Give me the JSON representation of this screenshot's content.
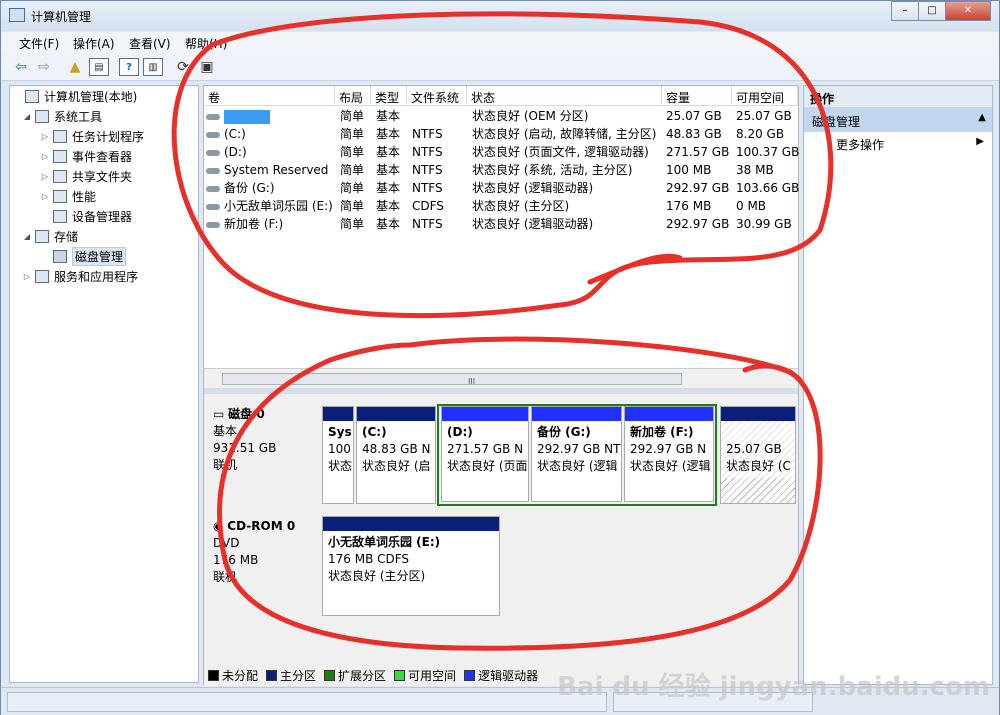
{
  "window": {
    "title": "计算机管理",
    "btn_min": "–",
    "btn_max": "□",
    "btn_close": "✕"
  },
  "menu": [
    "文件(F)",
    "操作(A)",
    "查看(V)",
    "帮助(H)"
  ],
  "tree": [
    {
      "label": "计算机管理(本地)",
      "expander": ""
    },
    {
      "label": "系统工具",
      "expander": "◢"
    },
    {
      "label": "任务计划程序",
      "expander": "▷"
    },
    {
      "label": "事件查看器",
      "expander": "▷"
    },
    {
      "label": "共享文件夹",
      "expander": "▷"
    },
    {
      "label": "性能",
      "expander": "▷"
    },
    {
      "label": "设备管理器",
      "expander": ""
    },
    {
      "label": "存储",
      "expander": "◢"
    },
    {
      "label": "磁盘管理",
      "expander": ""
    },
    {
      "label": "服务和应用程序",
      "expander": "▷"
    }
  ],
  "columns": [
    "卷",
    "布局",
    "类型",
    "文件系统",
    "状态",
    "容量",
    "可用空间"
  ],
  "volumes": [
    {
      "name": "",
      "layout": "简单",
      "type": "基本",
      "fs": "",
      "status": "状态良好 (OEM 分区)",
      "capacity": "25.07 GB",
      "free": "25.07 GB"
    },
    {
      "name": "(C:)",
      "layout": "简单",
      "type": "基本",
      "fs": "NTFS",
      "status": "状态良好 (启动, 故障转储, 主分区)",
      "capacity": "48.83 GB",
      "free": "8.20 GB"
    },
    {
      "name": "(D:)",
      "layout": "简单",
      "type": "基本",
      "fs": "NTFS",
      "status": "状态良好 (页面文件, 逻辑驱动器)",
      "capacity": "271.57 GB",
      "free": "100.37 GB"
    },
    {
      "name": "System Reserved",
      "layout": "简单",
      "type": "基本",
      "fs": "NTFS",
      "status": "状态良好 (系统, 活动, 主分区)",
      "capacity": "100 MB",
      "free": "38 MB"
    },
    {
      "name": "备份 (G:)",
      "layout": "简单",
      "type": "基本",
      "fs": "NTFS",
      "status": "状态良好 (逻辑驱动器)",
      "capacity": "292.97 GB",
      "free": "103.66 GB"
    },
    {
      "name": "小无敌单词乐园 (E:)",
      "layout": "简单",
      "type": "基本",
      "fs": "CDFS",
      "status": "状态良好 (主分区)",
      "capacity": "176 MB",
      "free": "0 MB"
    },
    {
      "name": "新加卷 (F:)",
      "layout": "简单",
      "type": "基本",
      "fs": "NTFS",
      "status": "状态良好 (逻辑驱动器)",
      "capacity": "292.97 GB",
      "free": "30.99 GB"
    }
  ],
  "scroll_thumb": "III",
  "disk0": {
    "title": "磁盘 0",
    "kind": "基本",
    "size": "931.51 GB",
    "state": "联机"
  },
  "cdrom": {
    "title": "CD-ROM 0",
    "kind": "DVD",
    "size": "176 MB",
    "state": "联机"
  },
  "partitions": [
    {
      "name": "Sys",
      "size": "100",
      "status": "状态"
    },
    {
      "name": "(C:)",
      "size": "48.83 GB N",
      "status": "状态良好 (启"
    },
    {
      "name": "(D:)",
      "size": "271.57 GB N",
      "status": "状态良好 (页面"
    },
    {
      "name": "备份 (G:)",
      "size": "292.97 GB NT",
      "status": "状态良好 (逻辑"
    },
    {
      "name": "新加卷 (F:)",
      "size": "292.97 GB N",
      "status": "状态良好 (逻辑"
    },
    {
      "name": "",
      "size": "25.07 GB",
      "status": "状态良好 (C"
    }
  ],
  "cd_partition": {
    "name": "小无敌单词乐园 (E:)",
    "size": "176 MB CDFS",
    "status": "状态良好 (主分区)"
  },
  "legend": [
    {
      "label": "未分配",
      "color": "#000000"
    },
    {
      "label": "主分区",
      "color": "#0a1f7a"
    },
    {
      "label": "扩展分区",
      "color": "#1c7d1c"
    },
    {
      "label": "可用空间",
      "color": "#33dd33"
    },
    {
      "label": "逻辑驱动器",
      "color": "#1f30ff"
    }
  ],
  "actions": {
    "header": "操作",
    "section": "磁盘管理",
    "more": "更多操作"
  },
  "watermark": "Bai du 经验 jingyan.baidu.com"
}
